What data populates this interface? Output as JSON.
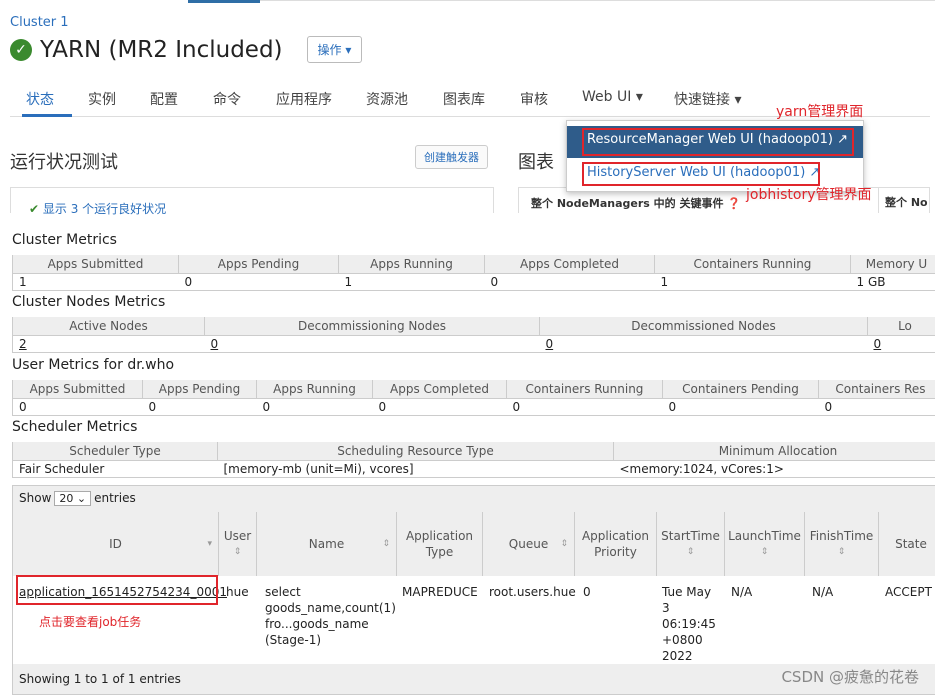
{
  "breadcrumb": "Cluster 1",
  "title": "YARN (MR2 Included)",
  "ops_button": "操作",
  "tabs": [
    "状态",
    "实例",
    "配置",
    "命令",
    "应用程序",
    "资源池",
    "图表库",
    "审核",
    "Web UI",
    "快速链接"
  ],
  "dropdown": {
    "rm": "ResourceManager Web UI (hadoop01)",
    "hs": "HistoryServer Web UI (hadoop01)"
  },
  "annotations": {
    "yarn": "yarn管理界面",
    "jobhistory": "jobhistory管理界面",
    "click": "点击要查看job任务"
  },
  "health": {
    "title": "运行状况测试",
    "trigger_button": "创建触发器",
    "summary": "显示 3 个运行良好状况"
  },
  "charts": {
    "title": "图表",
    "nm_events": "整个 NodeManagers 中的 关键事件",
    "nm_events_2": "整个 No"
  },
  "cluster_metrics": {
    "title": "Cluster Metrics",
    "headers": [
      "Apps Submitted",
      "Apps Pending",
      "Apps Running",
      "Apps Completed",
      "Containers Running",
      "Memory U"
    ],
    "values": [
      "1",
      "0",
      "1",
      "0",
      "1",
      "1 GB"
    ]
  },
  "nodes_metrics": {
    "title": "Cluster Nodes Metrics",
    "headers": [
      "Active Nodes",
      "Decommissioning Nodes",
      "Decommissioned Nodes",
      "Lo"
    ],
    "values": [
      "2",
      "0",
      "0",
      "0"
    ]
  },
  "user_metrics": {
    "title": "User Metrics for dr.who",
    "headers": [
      "Apps Submitted",
      "Apps Pending",
      "Apps Running",
      "Apps Completed",
      "Containers Running",
      "Containers Pending",
      "Containers Res"
    ],
    "values": [
      "0",
      "0",
      "0",
      "0",
      "0",
      "0",
      "0"
    ]
  },
  "scheduler_metrics": {
    "title": "Scheduler Metrics",
    "headers": [
      "Scheduler Type",
      "Scheduling Resource Type",
      "Minimum Allocation"
    ],
    "values": [
      "Fair Scheduler",
      "[memory-mb (unit=Mi), vcores]",
      "<memory:1024, vCores:1>"
    ]
  },
  "apps": {
    "show_prefix": "Show",
    "show_value": "20",
    "show_suffix": "entries",
    "headers": {
      "id": "ID",
      "user": "User",
      "name": "Name",
      "apptype": "Application Type",
      "queue": "Queue",
      "priority": "Application Priority",
      "start": "StartTime",
      "launch": "LaunchTime",
      "finish": "FinishTime",
      "state": "State"
    },
    "row": {
      "id": "application_1651452754234_0001",
      "user": "hue",
      "name_lines": [
        "select",
        "goods_name,count(1)",
        "fro...goods_name",
        "(Stage-1)"
      ],
      "apptype": "MAPREDUCE",
      "queue": "root.users.hue",
      "priority": "0",
      "start_lines": [
        "Tue May",
        "3",
        "06:19:45",
        "+0800",
        "2022"
      ],
      "launch": "N/A",
      "finish": "N/A",
      "state": "ACCEPT"
    },
    "footer": "Showing 1 to 1 of 1 entries"
  },
  "watermark": "CSDN @疲惫的花卷"
}
